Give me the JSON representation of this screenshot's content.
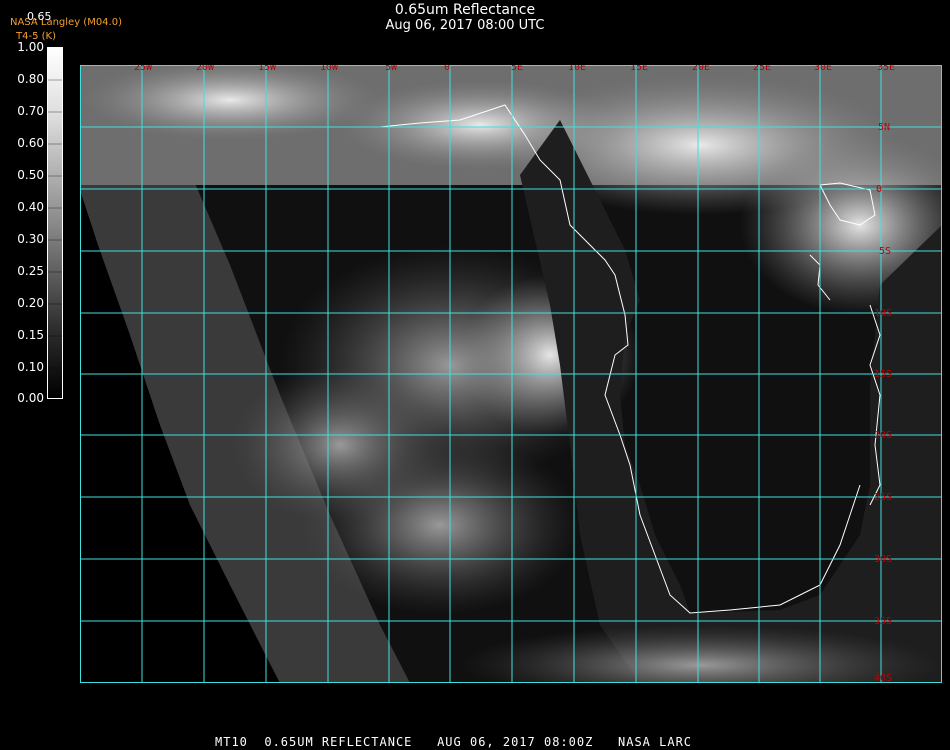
{
  "header": {
    "title": "0.65um Reflectance",
    "datetime": "Aug 06, 2017 08:00 UTC",
    "credit_line1": "NASA Langley (M04.0)",
    "credit_line2": "T4-5 (K)",
    "top_value": "0.65"
  },
  "colorbar": {
    "ticks": [
      "1.00",
      "0.80",
      "0.70",
      "0.60",
      "0.50",
      "0.40",
      "0.30",
      "0.25",
      "0.20",
      "0.15",
      "0.10",
      "0.00"
    ]
  },
  "map": {
    "grid_color": "#40e0e0",
    "coast_color": "#ffffff",
    "label_color": "#c00000",
    "lon_labels": [
      "25W",
      "20W",
      "15W",
      "10W",
      "5W",
      "0",
      "5E",
      "10E",
      "15E",
      "20E",
      "25E",
      "30E",
      "35E"
    ],
    "lat_labels": [
      "5N",
      "0",
      "5S",
      "10S",
      "15S",
      "20S",
      "25S",
      "30S",
      "35S",
      "40S"
    ]
  },
  "footer": {
    "text": "MT10  0.65UM REFLECTANCE   AUG 06, 2017 08:00Z   NASA LARC"
  }
}
